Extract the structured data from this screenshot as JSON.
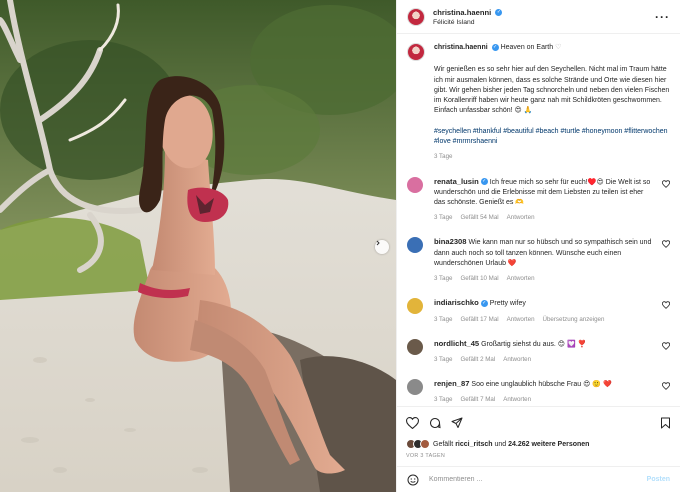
{
  "post": {
    "username": "christina.haenni",
    "location": "Félicité Island",
    "caption_title": "Heaven on Earth",
    "caption_text": "Wir genießen es so sehr hier auf den Seychellen. Nicht mal im Traum hätte ich mir ausmalen können, dass es solche Strände und Orte wie diesen hier gibt. Wir gehen bisher jeden Tag schnorcheln und neben den vielen Fischen im Korallenriff haben wir heute ganz nah mit Schildkröten geschwommen. Einfach unfassbar schön! 😍 🙏",
    "hashtags": "#seychellen #thankful #beautiful #beach #turtle #honeymoon #flitterwochen #love #mrmrshaenni",
    "caption_age": "3 Tage"
  },
  "comments": [
    {
      "user": "renata_lusin",
      "verified": true,
      "text": "Ich freue mich so sehr für euch!♥️😍 Die Welt ist so wunderschön und die Erlebnisse mit dem Liebsten zu teilen ist eher das schönste. Genießt es 🫶",
      "age": "3 Tage",
      "likes": "Gefällt 54 Mal",
      "reply": "Antworten",
      "extra": ""
    },
    {
      "user": "bina2308",
      "verified": false,
      "text": "Wie kann man nur so hübsch und so sympathisch sein und dann auch noch so toll tanzen können. Wünsche euch einen wunderschönen Urlaub ❤️",
      "age": "3 Tage",
      "likes": "Gefällt 10 Mal",
      "reply": "Antworten",
      "extra": ""
    },
    {
      "user": "indiarischko",
      "verified": true,
      "text": "Pretty wifey",
      "age": "3 Tage",
      "likes": "Gefällt 17 Mal",
      "reply": "Antworten",
      "extra": "Übersetzung anzeigen"
    },
    {
      "user": "nordlicht_45",
      "verified": false,
      "text": "Großartig siehst du aus. 😊 💟 ❣️",
      "age": "3 Tage",
      "likes": "Gefällt 2 Mal",
      "reply": "Antworten",
      "extra": ""
    },
    {
      "user": "renjen_87",
      "verified": false,
      "text": "Soo eine unglaublich hübsche Frau 😍 🙂 ❤️",
      "age": "3 Tage",
      "likes": "Gefällt 7 Mal",
      "reply": "Antworten",
      "extra": ""
    }
  ],
  "likes_line": {
    "prefix": "Gefällt ",
    "user": "ricci_ritsch",
    "mid": " und ",
    "count": "24.262 weitere Personen"
  },
  "date_label": "VOR 3 TAGEN",
  "comment_input": {
    "placeholder": "Kommentieren ...",
    "post_label": "Posten"
  },
  "colors": {
    "link": "#00376b",
    "verified": "#3897f0",
    "muted": "#8e8e8e",
    "post_button": "#b2dffc"
  }
}
